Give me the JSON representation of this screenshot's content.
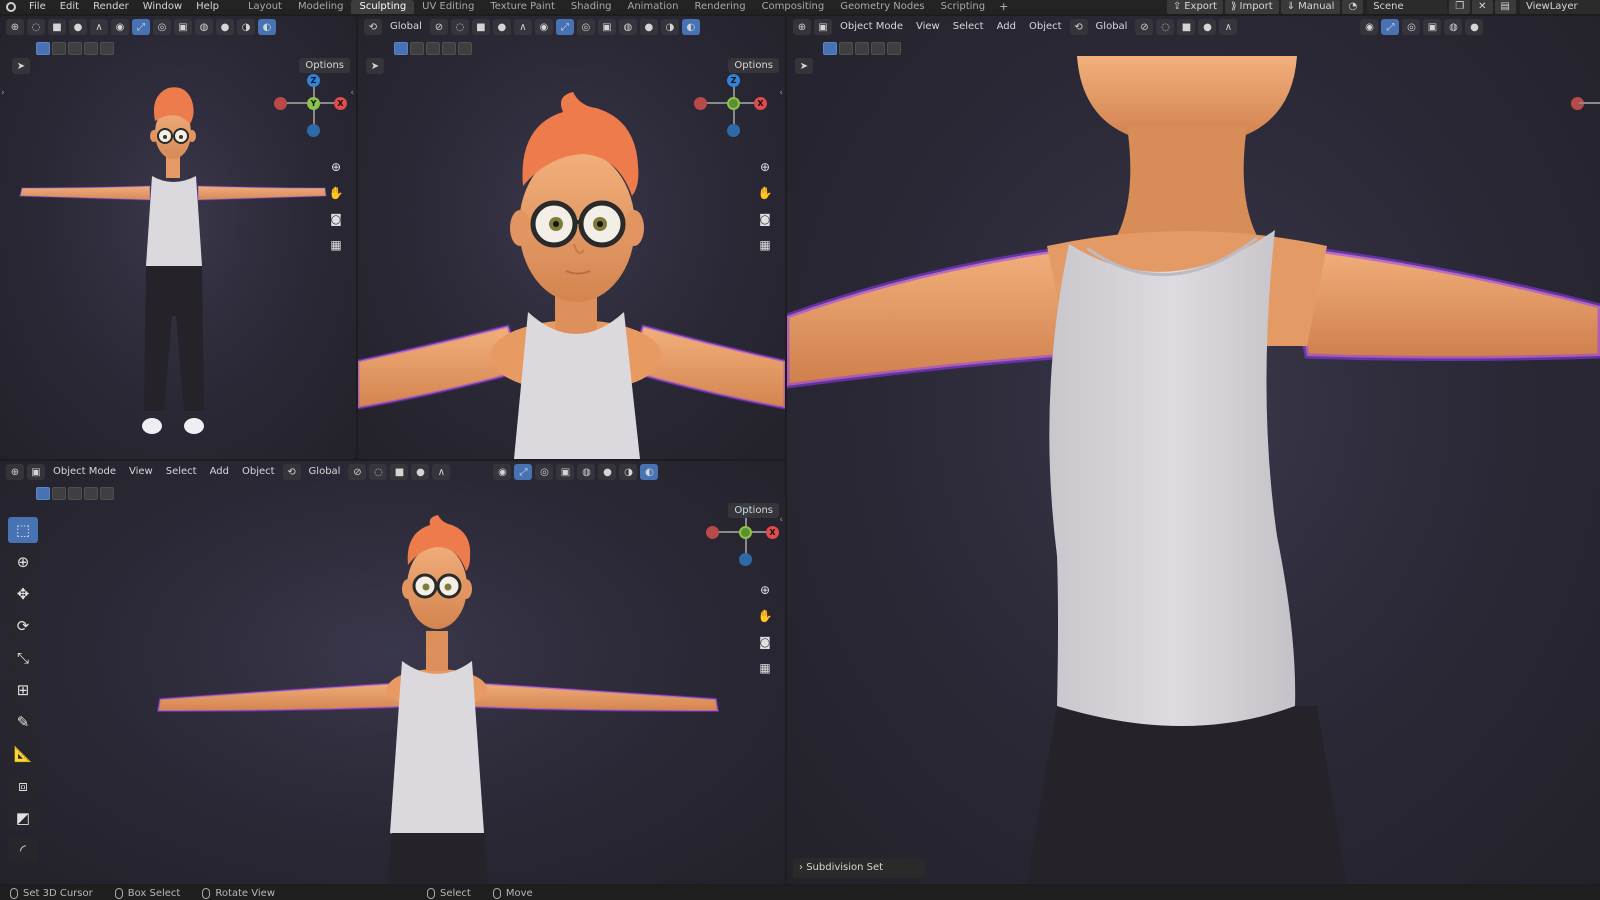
{
  "menu": [
    "File",
    "Edit",
    "Render",
    "Window",
    "Help"
  ],
  "workspaces": [
    {
      "label": "Layout",
      "active": false
    },
    {
      "label": "Modeling",
      "active": false
    },
    {
      "label": "Sculpting",
      "active": true
    },
    {
      "label": "UV Editing",
      "active": false
    },
    {
      "label": "Texture Paint",
      "active": false
    },
    {
      "label": "Shading",
      "active": false
    },
    {
      "label": "Animation",
      "active": false
    },
    {
      "label": "Rendering",
      "active": false
    },
    {
      "label": "Compositing",
      "active": false
    },
    {
      "label": "Geometry Nodes",
      "active": false
    },
    {
      "label": "Scripting",
      "active": false
    }
  ],
  "workspace_add": "+",
  "topright": {
    "export_label": "Export",
    "import_label": "Import",
    "manual_label": "Manual",
    "scene_name": "Scene",
    "view_layer": "ViewLayer"
  },
  "header": {
    "mode": "Object Mode",
    "view": "View",
    "select": "Select",
    "add": "Add",
    "object": "Object",
    "orientation": "Global",
    "options": "Options"
  },
  "gizmo": {
    "z": "Z",
    "y": "Y",
    "x": "X"
  },
  "operator_panel": "Subdivision Set",
  "status": [
    {
      "label": "Set 3D Cursor"
    },
    {
      "label": "Box Select"
    },
    {
      "label": "Rotate View"
    },
    {
      "label": "Select"
    },
    {
      "label": "Move"
    }
  ],
  "colors": {
    "accent": "#4772b3",
    "axis_x": "#e04b4b",
    "axis_y": "#8bc34a",
    "axis_z": "#2f84d8",
    "skin": "#e7a06c",
    "hair": "#ee7b4c",
    "shirt": "#d9d6dc",
    "pants": "#25222a",
    "rim": "#8f3cff"
  }
}
